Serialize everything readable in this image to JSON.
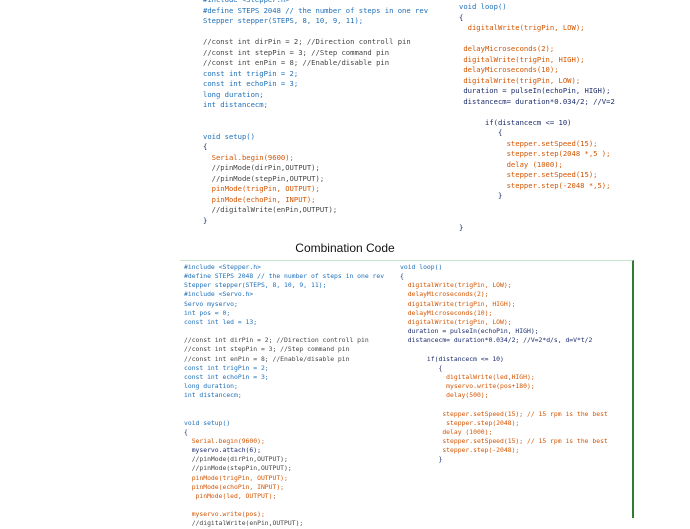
{
  "caption": "Combination Code",
  "top_code": {
    "left": [
      "#include <Stepper.h>",
      "#define STEPS 2048 // the number of steps in one rev",
      "Stepper stepper(STEPS, 8, 10, 9, 11);",
      "",
      "//const int dirPin = 2; //Direction controll pin",
      "//const int stepPin = 3; //Step command pin",
      "//const int enPin = 8; //Enable/disable pin",
      "const int trigPin = 2;",
      "const int echoPin = 3;",
      "long duration;",
      "int distancecm;",
      "",
      "",
      "void setup()",
      "{",
      "  Serial.begin(9600);",
      "  //pinMode(dirPin,OUTPUT);",
      "  //pinMode(stepPin,OUTPUT);",
      "  pinMode(trigPin, OUTPUT);",
      "  pinMode(echoPin, INPUT);",
      "  //digitalWrite(enPin,OUTPUT);",
      "}"
    ],
    "right": [
      "void loop()",
      "{",
      "  digitalWrite(trigPin, LOW);",
      "",
      " delayMicroseconds(2);",
      " digitalWrite(trigPin, HIGH);",
      " delayMicroseconds(10);",
      " digitalWrite(trigPin, LOW);",
      " duration = pulseIn(echoPin, HIGH);",
      " distancecm= duration*0.034/2; //V=2",
      "",
      "      if(distancecm <= 10)",
      "         {",
      "           stepper.setSpeed(15);",
      "           stepper.step(2048 *,5 );",
      "           delay (1000);",
      "           stepper.setSpeed(15);",
      "           stepper.step(-2048 *,5);",
      "         }",
      "",
      "",
      "}"
    ]
  },
  "bottom_code": {
    "left": [
      "#include <Stepper.h>",
      "#define STEPS 2048 // the number of steps in one rev",
      "Stepper stepper(STEPS, 8, 10, 9, 11);",
      "#include <Servo.h>",
      "Servo myservo;",
      "int pos = 0;",
      "const int led = 13;",
      "",
      "//const int dirPin = 2; //Direction controll pin",
      "//const int stepPin = 3; //Step command pin",
      "//const int enPin = 8; //Enable/disable pin",
      "const int trigPin = 2;",
      "const int echoPin = 3;",
      "long duration;",
      "int distancecm;",
      "",
      "",
      "void setup()",
      "{",
      "  Serial.begin(9600);",
      "  myservo.attach(6);",
      "  //pinMode(dirPin,OUTPUT);",
      "  //pinMode(stepPin,OUTPUT);",
      "  pinMode(trigPin, OUTPUT);",
      "  pinMode(echoPin, INPUT);",
      "   pinMode(led, OUTPUT);",
      "",
      "  myservo.write(pos);",
      "  //digitalWrite(enPin,OUTPUT);"
    ],
    "right": [
      "void loop()",
      "{",
      "  digitalWrite(trigPin, LOW);",
      "  delayMicroseconds(2);",
      "  digitalWrite(trigPin, HIGH);",
      "  delayMicroseconds(10);",
      "  digitalWrite(trigPin, LOW);",
      "  duration = pulseIn(echoPin, HIGH);",
      "  distancecm= duration*0.034/2; //V=2*d/s, d=V*t/2",
      "",
      "       if(distancecm <= 10)",
      "          {",
      "            digitalWrite(led,HIGH);",
      "            myservo.write(pos+180);",
      "            delay(500);",
      "",
      "           stepper.setSpeed(15); // 15 rpm is the best",
      "            stepper.step(2048);",
      "           delay (1000);",
      "           stepper.setSpeed(15); // 15 rpm is the best",
      "           stepper.step(-2048);",
      "          }"
    ]
  }
}
